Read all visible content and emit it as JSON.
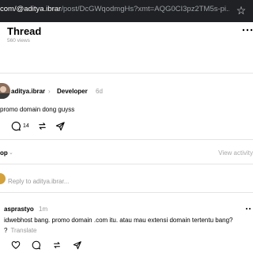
{
  "browser": {
    "url_main": "com/@aditya.ibrar",
    "url_path": "/post/DcGWqodmgHs?xmt=AQG0CI3pz2TM5s-pi...",
    "bookmark_icon": "star-icon"
  },
  "header": {
    "title": "Thread",
    "views": "560 views",
    "more_icon": "more-icon"
  },
  "post": {
    "author": "aditya.ibrar",
    "separator": "›",
    "tag": "Developer",
    "time": "6d",
    "text": "promo domain dong guyss",
    "reply_count": "14",
    "icons": [
      "comment-icon",
      "repost-icon",
      "share-icon"
    ]
  },
  "sort": {
    "label": "op",
    "chevron": "⌄",
    "view_activity": "View activity"
  },
  "reply_box": {
    "placeholder": "Reply to aditya.ibrar..."
  },
  "reply": {
    "author": "asprastyo",
    "time": "1m",
    "text": "idwebhost bang. promo domain .com itu. atau mau extensi domain tertentu bang?",
    "translate_prefix": "?",
    "translate": "Translate",
    "icons": [
      "heart-icon",
      "comment-icon",
      "repost-icon",
      "share-icon"
    ]
  }
}
